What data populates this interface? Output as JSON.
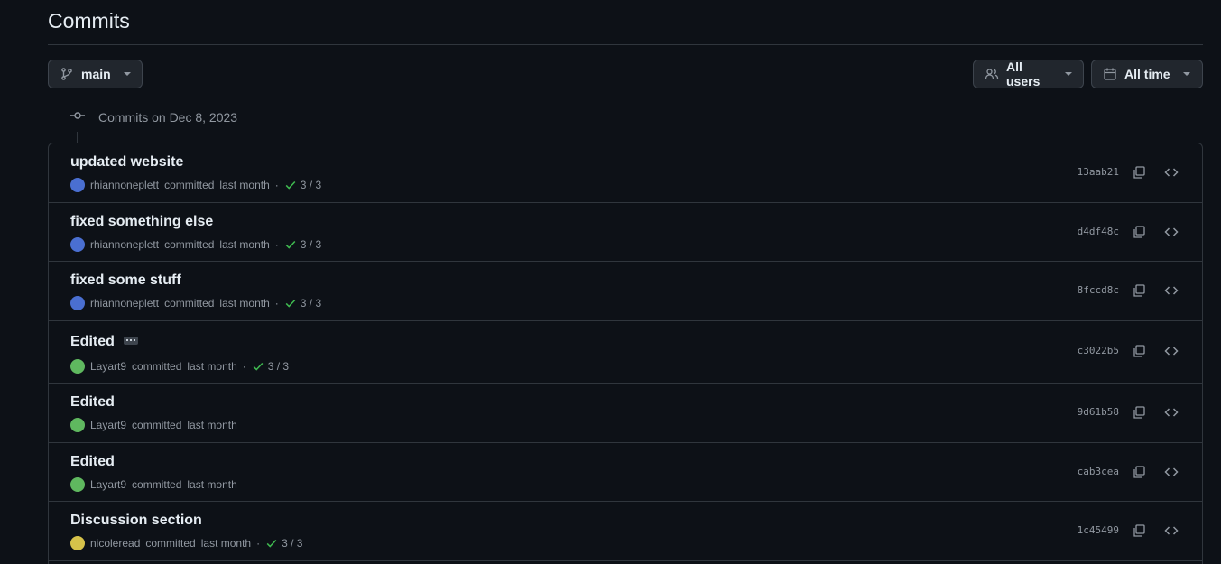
{
  "header": {
    "title": "Commits"
  },
  "filters": {
    "branch": "main",
    "users": "All users",
    "time": "All time"
  },
  "group": {
    "label": "Commits on Dec 8, 2023"
  },
  "commits": [
    {
      "message": "updated website",
      "author": "rhiannoneplett",
      "action": "committed",
      "when": "last month",
      "checks": "3 / 3",
      "sha": "13aab21",
      "avatar_color": "#4a6fd1"
    },
    {
      "message": "fixed something else",
      "author": "rhiannoneplett",
      "action": "committed",
      "when": "last month",
      "checks": "3 / 3",
      "sha": "d4df48c",
      "avatar_color": "#4a6fd1"
    },
    {
      "message": "fixed some stuff",
      "author": "rhiannoneplett",
      "action": "committed",
      "when": "last month",
      "checks": "3 / 3",
      "sha": "8fccd8c",
      "avatar_color": "#4a6fd1"
    },
    {
      "message": "Edited",
      "author": "Layart9",
      "action": "committed",
      "when": "last month",
      "checks": "3 / 3",
      "sha": "c3022b5",
      "avatar_color": "#5fb85f"
    },
    {
      "message": "Edited",
      "author": "Layart9",
      "action": "committed",
      "when": "last month",
      "checks": "",
      "sha": "9d61b58",
      "avatar_color": "#5fb85f"
    },
    {
      "message": "Edited",
      "author": "Layart9",
      "action": "committed",
      "when": "last month",
      "checks": "",
      "sha": "cab3cea",
      "avatar_color": "#5fb85f"
    },
    {
      "message": "Discussion section",
      "author": "nicoleread",
      "action": "committed",
      "when": "last month",
      "checks": "3 / 3",
      "sha": "1c45499",
      "avatar_color": "#d6c24a"
    }
  ],
  "colors": {
    "success": "#3fb950",
    "border": "#30363d",
    "muted": "#9198a1"
  }
}
